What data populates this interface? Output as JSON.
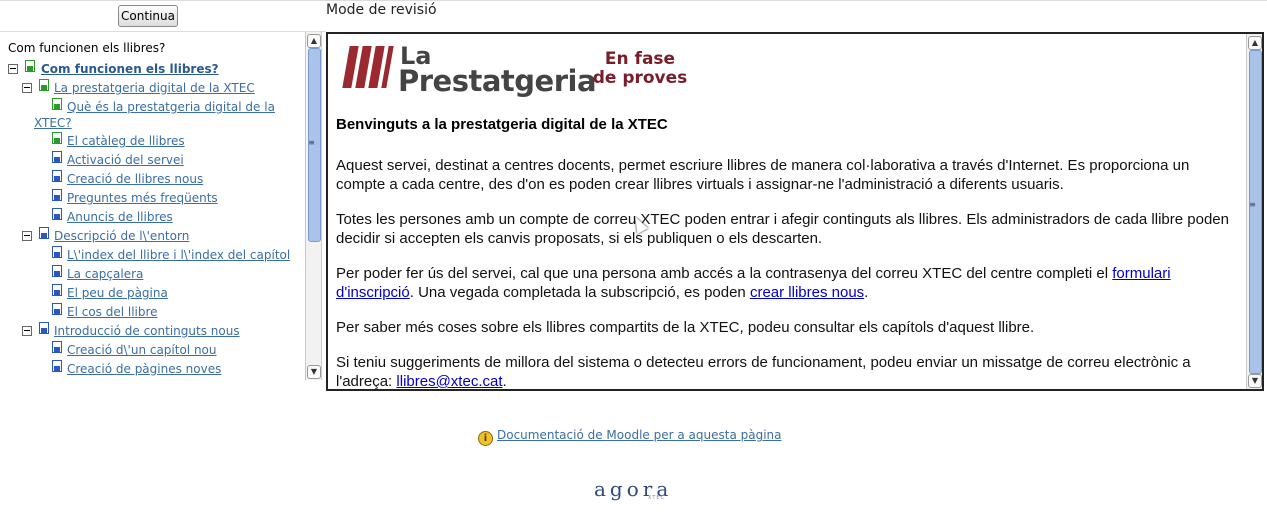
{
  "header": {
    "continue_label": "Continua",
    "mode_title": "Mode de revisió"
  },
  "toc": {
    "heading": "Com funcionen els llibres?",
    "items": [
      {
        "label": "Com funcionen els llibres?",
        "level": 0,
        "icon": "green-page-icon",
        "toggle": true
      },
      {
        "label": "La prestatgeria digital de la XTEC",
        "level": 1,
        "icon": "green-page-icon",
        "toggle": true
      },
      {
        "label": "Què és la prestatgeria digital de la XTEC?",
        "level": 2,
        "icon": "green-page-icon"
      },
      {
        "label": "El catàleg de llibres",
        "level": 2,
        "icon": "green-page-icon"
      },
      {
        "label": "Activació del servei",
        "level": 2,
        "icon": "blue-page-icon"
      },
      {
        "label": "Creació de llibres nous",
        "level": 2,
        "icon": "blue-page-icon"
      },
      {
        "label": "Preguntes més freqüents",
        "level": 2,
        "icon": "blue-page-icon"
      },
      {
        "label": "Anuncis de llibres",
        "level": 2,
        "icon": "blue-page-icon"
      },
      {
        "label": "Descripció de l\\'entorn",
        "level": 1,
        "icon": "blue-page-icon",
        "toggle": true
      },
      {
        "label": "L\\'index del llibre i l\\'index del capítol",
        "level": 2,
        "icon": "blue-page-icon"
      },
      {
        "label": "La capçalera",
        "level": 2,
        "icon": "blue-page-icon"
      },
      {
        "label": "El peu de pàgina",
        "level": 2,
        "icon": "blue-page-icon"
      },
      {
        "label": "El cos del llibre",
        "level": 2,
        "icon": "blue-page-icon"
      },
      {
        "label": "Introducció de continguts nous",
        "level": 1,
        "icon": "blue-page-icon",
        "toggle": true
      },
      {
        "label": "Creació d\\'un capítol nou",
        "level": 2,
        "icon": "blue-page-icon"
      },
      {
        "label": "Creació de pàgines noves",
        "level": 2,
        "icon": "blue-page-icon"
      }
    ]
  },
  "content": {
    "logo_small": "La",
    "logo_large": "Prestatgeria",
    "beta_line1": "En fase",
    "beta_line2": "de proves",
    "title": "Benvinguts a la prestatgeria digital de la XTEC",
    "p1": "Aquest servei, destinat a centres docents, permet escriure llibres de manera col·laborativa a través d'Internet. Es proporciona un compte a cada centre, des d'on es poden crear llibres virtuals i assignar-ne l'administració a diferents usuaris.",
    "p2": "Totes les persones amb un compte de correu XTEC poden entrar i afegir continguts als llibres. Els administradors de cada llibre poden decidir si accepten els canvis proposats, si els publiquen o els descarten.",
    "p3_before": "Per poder fer ús del servei, cal que una persona amb accés a la contrasenya del correu XTEC del centre completi el ",
    "p3_link1": "formulari d'inscripció",
    "p3_middle": ". Una vegada completada la subscripció, es poden ",
    "p3_link2": "crear llibres nous",
    "p3_after": ".",
    "p4": "Per saber més coses sobre els llibres compartits de la XTEC, podeu consultar els capítols d'aquest llibre.",
    "p5_before": "Si teniu suggeriments de millora del sistema o detecteu errors de funcionament, podeu enviar un missatge de correu electrònic a l'adreça: ",
    "p5_link": "llibres@xtec.cat",
    "p5_after": "."
  },
  "footer": {
    "doc_link": "Documentació de Moodle per a aquesta pàgina",
    "brand": "agora",
    "brand_sub": "XTEC"
  },
  "colors": {
    "link": "#3a6ea5",
    "logo_red": "#9a2a30",
    "beta": "#7a1d2a",
    "scroll_thumb": "#a9c3ea"
  }
}
